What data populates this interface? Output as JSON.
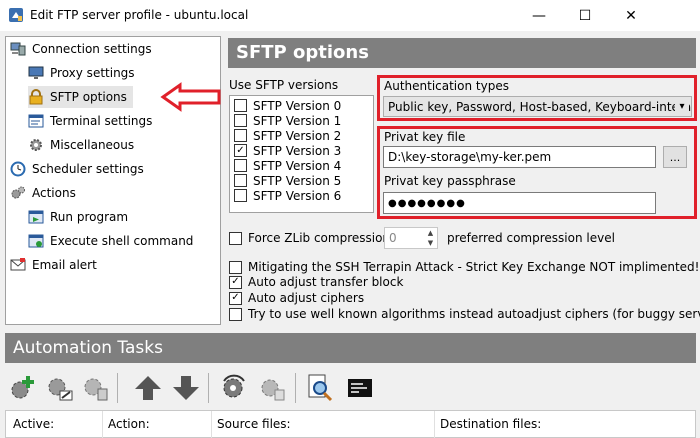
{
  "window": {
    "title": "Edit FTP server profile - ubuntu.local",
    "minimize": "—",
    "maximize": "☐",
    "close": "✕"
  },
  "sidebar": {
    "items": [
      {
        "label": "Connection settings",
        "icon": "computer-icon"
      },
      {
        "label": "Proxy settings",
        "icon": "monitor-icon"
      },
      {
        "label": "SFTP options",
        "icon": "lock-icon"
      },
      {
        "label": "Terminal settings",
        "icon": "terminal-window-icon"
      },
      {
        "label": "Miscellaneous",
        "icon": "gear-icon"
      },
      {
        "label": "Scheduler settings",
        "icon": "clock-icon"
      },
      {
        "label": "Actions",
        "icon": "gears-icon"
      },
      {
        "label": "Run program",
        "icon": "program-icon"
      },
      {
        "label": "Execute shell command",
        "icon": "shell-command-icon"
      },
      {
        "label": "Email alert",
        "icon": "email-icon"
      }
    ],
    "selected": "SFTP options"
  },
  "panel": {
    "title": "SFTP options",
    "versions_label": "Use SFTP versions",
    "versions": [
      {
        "label": "SFTP Version 0",
        "checked": false
      },
      {
        "label": "SFTP Version 1",
        "checked": false
      },
      {
        "label": "SFTP Version 2",
        "checked": false
      },
      {
        "label": "SFTP Version 3",
        "checked": true
      },
      {
        "label": "SFTP Version 4",
        "checked": false
      },
      {
        "label": "SFTP Version 5",
        "checked": false
      },
      {
        "label": "SFTP Version 6",
        "checked": false
      }
    ],
    "auth_label": "Authentication types",
    "auth_value": "Public key, Password, Host-based, Keyboard-interactiv",
    "key_file_label": "Privat key file",
    "key_file_value": "D:\\key-storage\\my-ker.pem",
    "browse_label": "...",
    "passphrase_label": "Privat key passphrase",
    "passphrase_value": "●●●●●●●●",
    "zlib_label": "Force ZLib compression",
    "zlib_checked": false,
    "compression_level": "0",
    "compression_level_label": "preferred compression level",
    "options": [
      {
        "label": "Mitigating the SSH Terrapin Attack - Strict Key Exchange NOT implimented!",
        "checked": false
      },
      {
        "label": "Auto adjust transfer block",
        "checked": true
      },
      {
        "label": "Auto adjust ciphers",
        "checked": true
      },
      {
        "label": "Try to use well known algorithms instead autoadjust ciphers (for buggy servers)",
        "checked": false
      }
    ]
  },
  "automation": {
    "title": "Automation Tasks",
    "toolbar": [
      "add-task-icon",
      "edit-task-icon",
      "delete-task-icon",
      "move-up-icon",
      "move-down-icon",
      "run-task-icon",
      "copy-task-icon",
      "search-log-icon",
      "console-icon"
    ],
    "columns": [
      "Active:",
      "Action:",
      "Source files:",
      "Destination files:"
    ]
  },
  "colors": {
    "highlight_red": "#e0202a",
    "header_gray": "#7f7f7f",
    "selected_bg": "#e5e5e5"
  }
}
